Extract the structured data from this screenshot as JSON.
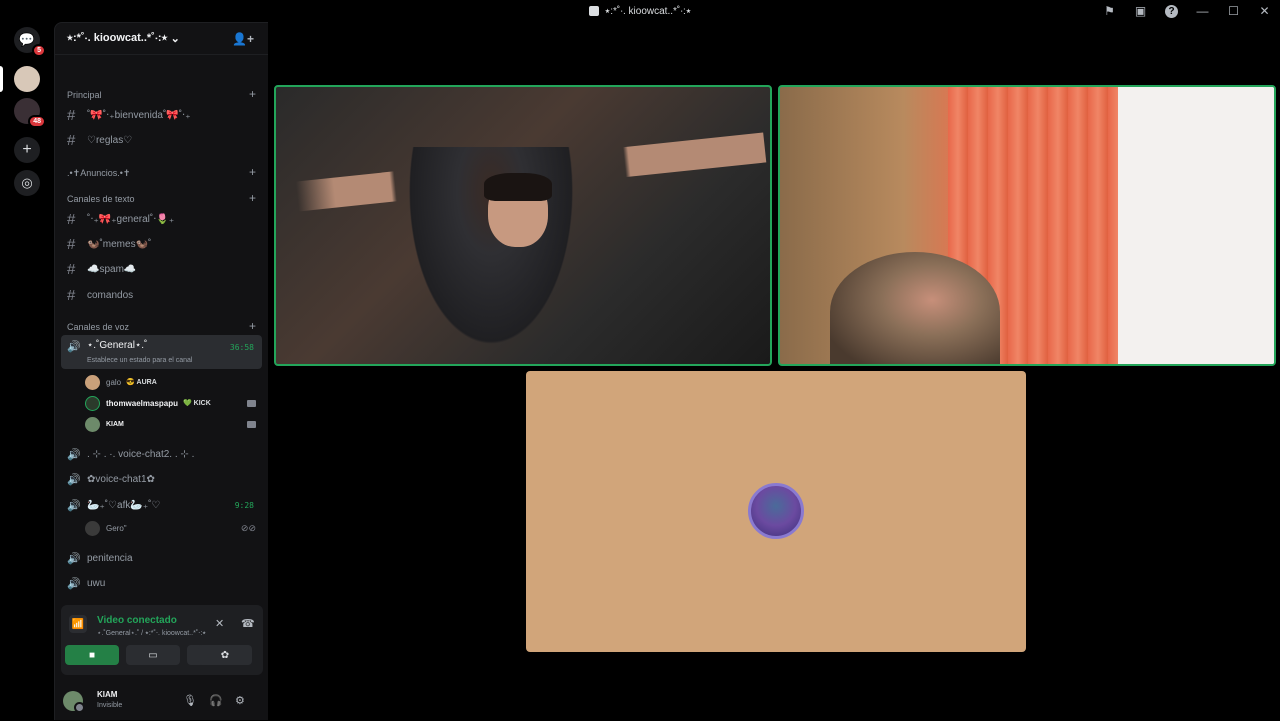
{
  "window": {
    "title": "⭑:*˚‧. kioowcat..*˚‧:⭑"
  },
  "servers": [
    {
      "name": "discord-home-icon",
      "badge": "5"
    },
    {
      "name": "server-1",
      "badge": ""
    },
    {
      "name": "server-2",
      "badge": "48"
    }
  ],
  "sidebar": {
    "guild_name": "⭑:*˚‧. kioowcat..*˚‧:⭑",
    "categories": {
      "principal": "Principal",
      "anuncios": ".•✝Anuncios.•✝",
      "texto": "Canales de texto",
      "voz": "Canales de voz"
    },
    "text_channels_principal": [
      "˚🎀˚‧₊bienvenida˚🎀˚‧₊",
      "♡reglas♡"
    ],
    "text_channels": [
      "˚‧₊🎀₊general˚‧🌷₊",
      "🦦˚memes🦦˚",
      "☁️spam☁️",
      "comandos"
    ],
    "active_voice": {
      "name": "⋆.˚General⋆.˚",
      "time": "36:58",
      "status_hint": "Establece un estado para el canal"
    },
    "members": [
      {
        "name": "galo",
        "tag": "😎 AURA"
      },
      {
        "name": "thomwaelmaspapu",
        "tag": "💚 KICK"
      },
      {
        "name": "KIAM",
        "tag": ""
      }
    ],
    "voice_channels": [
      {
        "name": ". ⊹ . ·. voice-chat2. . ⊹ .",
        "time": ""
      },
      {
        "name": "✿voice-chat1✿",
        "time": ""
      },
      {
        "name": "🦢₊˚♡afk🦢₊˚♡",
        "time": "9:28"
      }
    ],
    "afk_member": "Gero\"",
    "other_voice": [
      "penitencia",
      "uwu"
    ]
  },
  "voice_panel": {
    "status": "Video conectado",
    "location": "⋆.˚General⋆.˚ / ⭑:*˚‧. kioowcat..*˚‧:⭑"
  },
  "user": {
    "name": "KIAM",
    "status": "Invisible"
  },
  "colors": {
    "connected": "#23a55a",
    "camera_on": "#248046",
    "center_tile_bg": "#d1a57a"
  }
}
